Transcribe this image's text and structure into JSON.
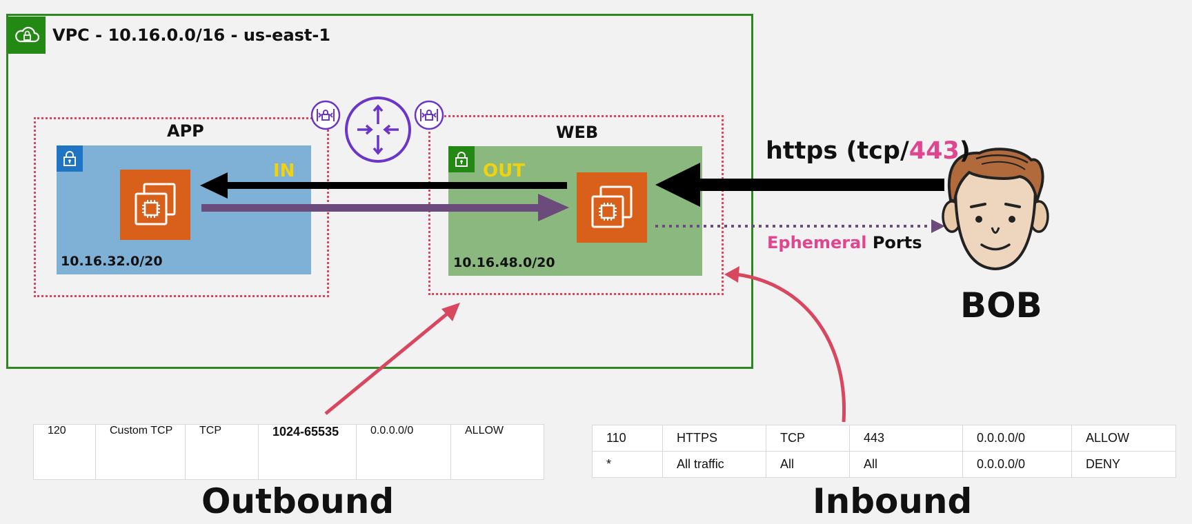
{
  "vpc": {
    "title": "VPC - 10.16.0.0/16 - us-east-1",
    "icon": "cloud-lock-icon"
  },
  "app": {
    "label": "APP",
    "cidr": "10.16.32.0/20",
    "flow_label": "IN"
  },
  "web": {
    "label": "WEB",
    "cidr": "10.16.48.0/20",
    "flow_label": "OUT"
  },
  "traffic": {
    "protocol_prefix": "https (tcp/",
    "port": "443",
    "protocol_suffix": ")",
    "ephemeral_word": "Ephemeral",
    "ports_word": "Ports"
  },
  "client": {
    "name": "BOB"
  },
  "outbound": {
    "label": "Outbound",
    "rows": [
      [
        "120",
        "Custom TCP",
        "TCP",
        "1024-65535",
        "0.0.0.0/0",
        "ALLOW"
      ]
    ]
  },
  "inbound": {
    "label": "Inbound",
    "rows": [
      [
        "110",
        "HTTPS",
        "TCP",
        "443",
        "0.0.0.0/0",
        "ALLOW"
      ],
      [
        "*",
        "All traffic",
        "All",
        "All",
        "0.0.0.0/0",
        "DENY"
      ]
    ]
  },
  "colors": {
    "vpc_border": "#2b8a1e",
    "nacl_border": "#d9475f",
    "app_subnet": "#7fb0d6",
    "web_subnet": "#8bb87f",
    "ec2": "#d9601a",
    "response_arrow": "#6b4a7c",
    "accent_pink": "#e0468f",
    "flow_label": "#f1d20e",
    "router": "#6a35c8"
  }
}
